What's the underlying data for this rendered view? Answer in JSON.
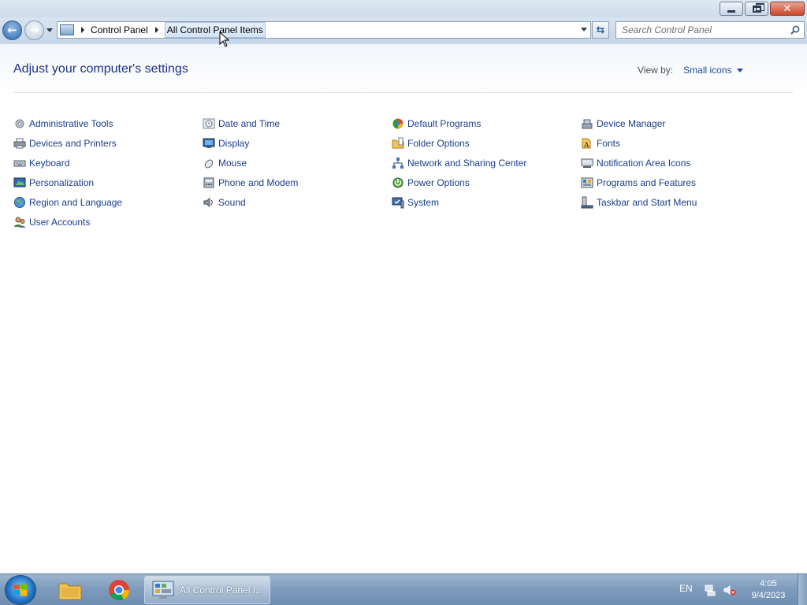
{
  "window": {
    "controls": {
      "minimize": "minimize",
      "maximize": "restore",
      "close": "close"
    }
  },
  "navigation": {
    "breadcrumb": [
      "Control Panel",
      "All Control Panel Items"
    ],
    "search_placeholder": "Search Control Panel"
  },
  "main": {
    "title": "Adjust your computer's settings",
    "view_by_label": "View by:",
    "view_by_value": "Small icons",
    "items": [
      {
        "label": "Administrative Tools",
        "icon": "tools-icon"
      },
      {
        "label": "Date and Time",
        "icon": "clock-icon"
      },
      {
        "label": "Default Programs",
        "icon": "default-programs-icon"
      },
      {
        "label": "Device Manager",
        "icon": "device-manager-icon"
      },
      {
        "label": "Devices and Printers",
        "icon": "printer-icon"
      },
      {
        "label": "Display",
        "icon": "display-icon"
      },
      {
        "label": "Folder Options",
        "icon": "folder-options-icon"
      },
      {
        "label": "Fonts",
        "icon": "fonts-icon"
      },
      {
        "label": "Keyboard",
        "icon": "keyboard-icon"
      },
      {
        "label": "Mouse",
        "icon": "mouse-icon"
      },
      {
        "label": "Network and Sharing Center",
        "icon": "network-icon"
      },
      {
        "label": "Notification Area Icons",
        "icon": "notification-icon"
      },
      {
        "label": "Personalization",
        "icon": "personalization-icon"
      },
      {
        "label": "Phone and Modem",
        "icon": "phone-icon"
      },
      {
        "label": "Power Options",
        "icon": "power-icon"
      },
      {
        "label": "Programs and Features",
        "icon": "programs-icon"
      },
      {
        "label": "Region and Language",
        "icon": "globe-icon"
      },
      {
        "label": "Sound",
        "icon": "speaker-icon"
      },
      {
        "label": "System",
        "icon": "system-icon"
      },
      {
        "label": "Taskbar and Start Menu",
        "icon": "taskbar-icon"
      },
      {
        "label": "User Accounts",
        "icon": "users-icon"
      }
    ]
  },
  "taskbar": {
    "active_window_label": "All Control Panel I...",
    "language": "EN",
    "time": "4:05",
    "date": "9/4/2023"
  },
  "colors": {
    "link": "#1b3e8a",
    "title": "#1e3287",
    "taskbar": "#7e9cbd"
  }
}
